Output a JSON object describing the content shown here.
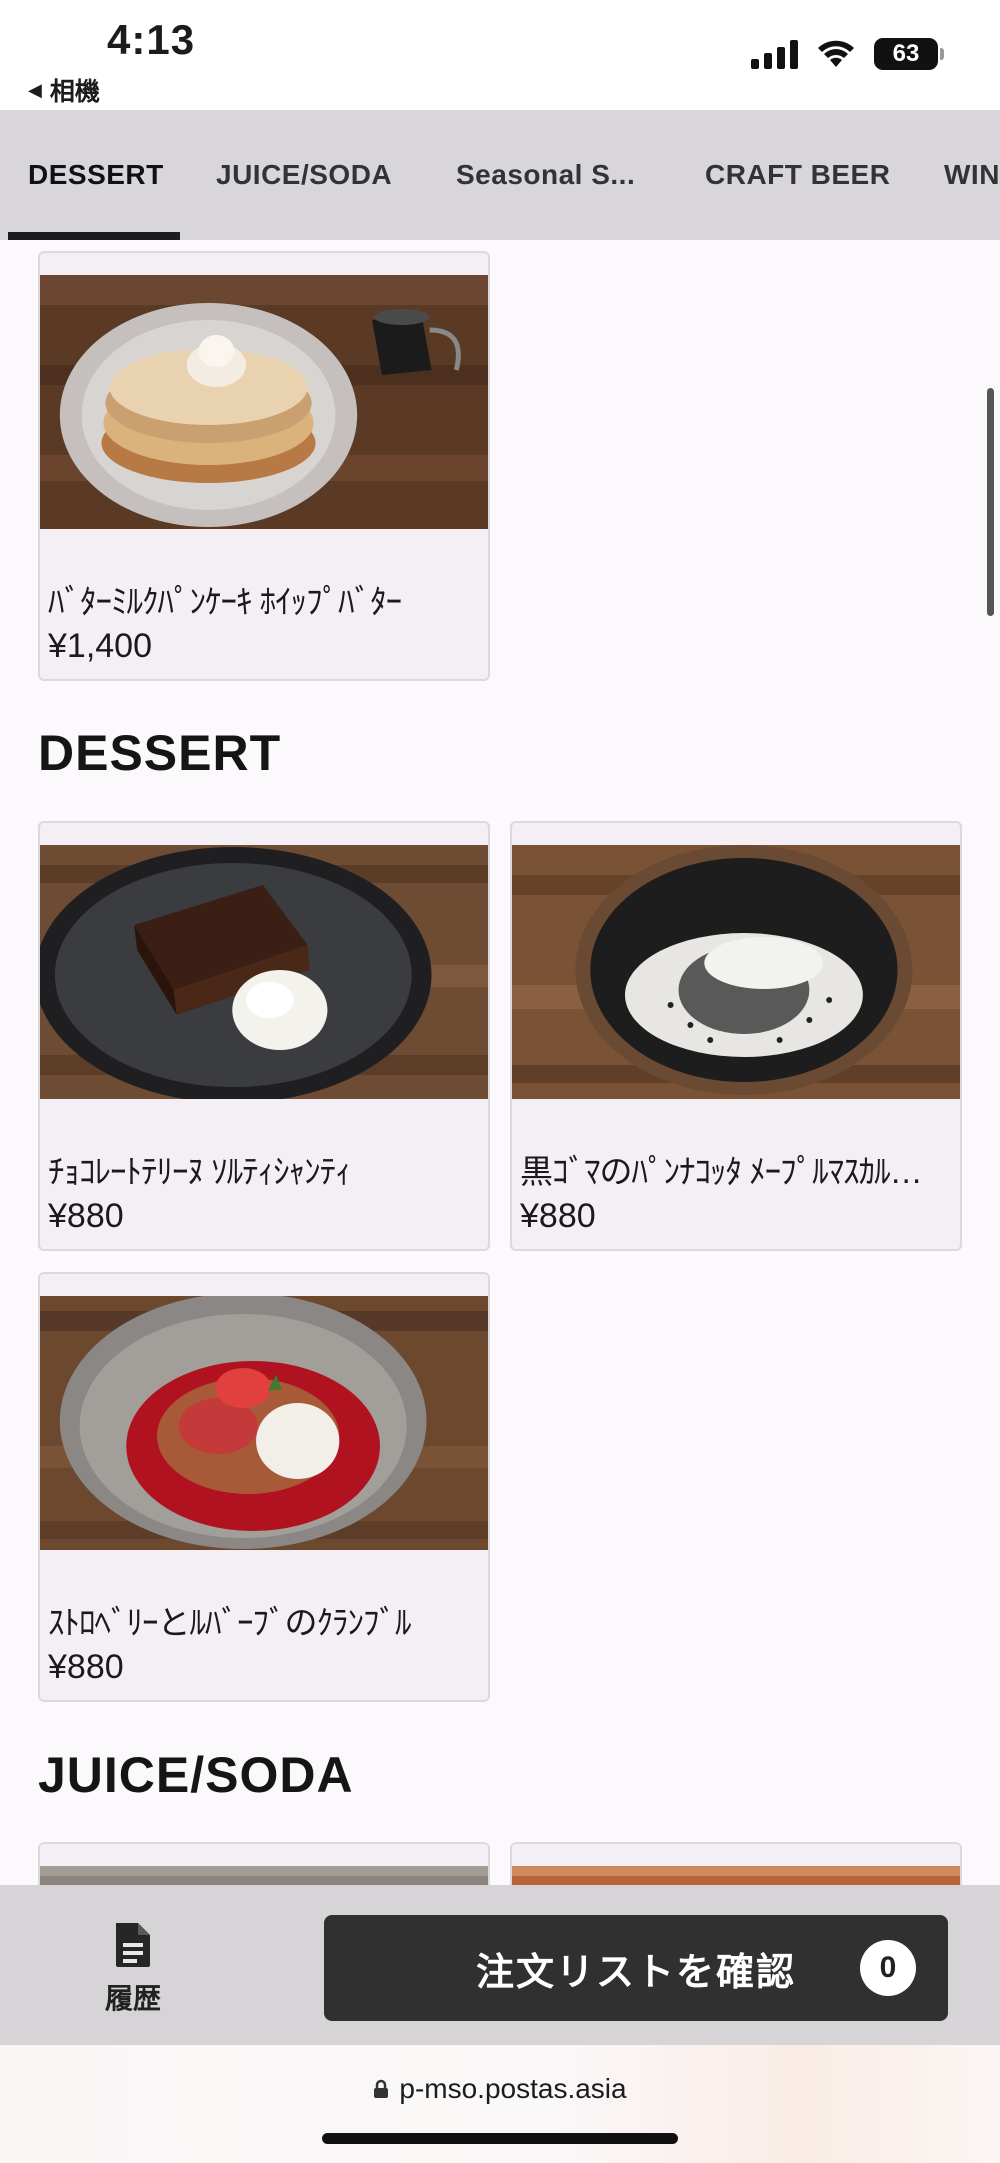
{
  "status_bar": {
    "time": "4:13",
    "back_app": "相機",
    "battery": "63"
  },
  "tabs": [
    {
      "label": "DESSERT",
      "active": true
    },
    {
      "label": "JUICE/SODA",
      "active": false
    },
    {
      "label": "Seasonal S...",
      "active": false
    },
    {
      "label": "CRAFT BEER",
      "active": false
    },
    {
      "label": "WIN",
      "active": false
    }
  ],
  "items": {
    "pancake": {
      "name": "ﾊﾞﾀｰﾐﾙｸﾊﾟﾝｹｰｷ ﾎｲｯﾌﾟﾊﾞﾀｰ",
      "price": "¥1,400"
    },
    "terrine": {
      "name": "ﾁｮｺﾚｰﾄﾃﾘｰﾇ ｿﾙﾃｨｼｬﾝﾃｨ",
      "price": "¥880"
    },
    "pannacotta": {
      "name": "黒ｺﾞﾏのﾊﾟﾝﾅｺｯﾀ ﾒｰﾌﾟﾙﾏｽｶﾙﾎﾟｰﾈ",
      "price": "¥880"
    },
    "crumble": {
      "name": "ｽﾄﾛﾍﾞﾘｰとﾙﾊﾞｰﾌﾞのｸﾗﾝﾌﾞﾙ",
      "price": "¥880"
    }
  },
  "sections": {
    "dessert": "DESSERT",
    "juice_soda": "JUICE/SODA"
  },
  "bottom_bar": {
    "history_label": "履歴",
    "confirm_label": "注文リストを確認",
    "order_count": "0"
  },
  "browser": {
    "url": "p-mso.postas.asia"
  }
}
